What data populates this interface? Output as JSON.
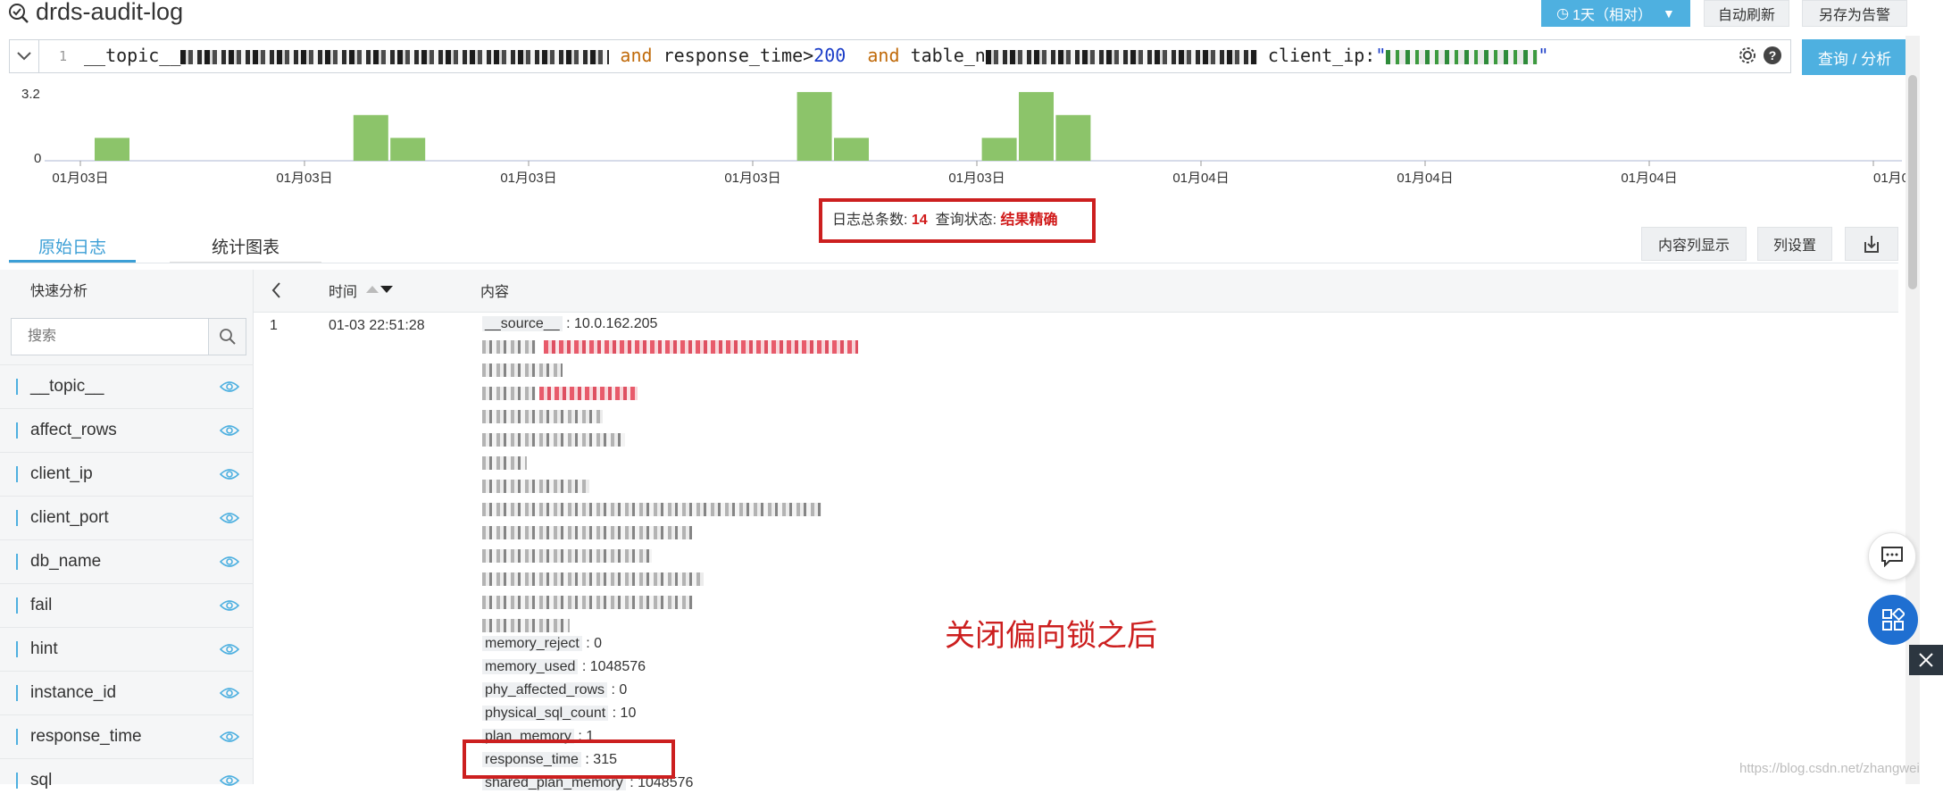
{
  "header": {
    "title": "drds-audit-log",
    "time_range": "1天（相对）",
    "auto_refresh": "自动刷新",
    "save_alert": "另存为告警"
  },
  "query": {
    "line_number": "1",
    "topic_key": "__topic__",
    "kw_and_1": "and",
    "response_clause": "response_time>",
    "response_value": "200",
    "kw_and_2": "and",
    "table_key": "table_n",
    "client_ip_key": "client_ip:",
    "quote": "\"",
    "button": "查询 / 分析"
  },
  "histogram": {
    "ymax_label": "3.2",
    "ymin_label": "0",
    "ticks": [
      "01月03日",
      "01月03日",
      "01月03日",
      "01月03日",
      "01月03日",
      "01月04日",
      "01月04日",
      "01月04日",
      "01月0"
    ],
    "bar_color": "#8cc46a",
    "ymax": 3.2,
    "bars": [
      1,
      0,
      0,
      0,
      0,
      0,
      0,
      2,
      1,
      0,
      0,
      0,
      0,
      0,
      0,
      0,
      0,
      0,
      0,
      3,
      1,
      0,
      0,
      0,
      1,
      3,
      2
    ]
  },
  "summary": {
    "count_label": "日志总条数:",
    "count": "14",
    "status_label": "查询状态:",
    "status": "结果精确"
  },
  "tabs": {
    "raw": "原始日志",
    "chart": "统计图表"
  },
  "actions": {
    "content_columns": "内容列显示",
    "column_settings": "列设置"
  },
  "sidebar": {
    "title": "快速分析",
    "search_placeholder": "搜索",
    "fields": [
      "__topic__",
      "affect_rows",
      "client_ip",
      "client_port",
      "db_name",
      "fail",
      "hint",
      "instance_id",
      "response_time",
      "sql"
    ]
  },
  "table": {
    "col_time": "时间",
    "col_content": "内容",
    "row": {
      "index": "1",
      "time": "01-03 22:51:28",
      "source_key": "__source__",
      "source_value": "10.0.162.205",
      "fields": [
        {
          "key": "memory_reject",
          "value": "0"
        },
        {
          "key": "memory_used",
          "value": "1048576"
        },
        {
          "key": "phy_affected_rows",
          "value": "0"
        },
        {
          "key": "physical_sql_count",
          "value": "10"
        },
        {
          "key": "plan_memory",
          "value": "1"
        },
        {
          "key": "response_time",
          "value": "315"
        },
        {
          "key": "shared_plan_memory",
          "value": "1048576"
        }
      ]
    }
  },
  "annotation": "关闭偏向锁之后",
  "watermark": "https://blog.csdn.net/zhangwei"
}
